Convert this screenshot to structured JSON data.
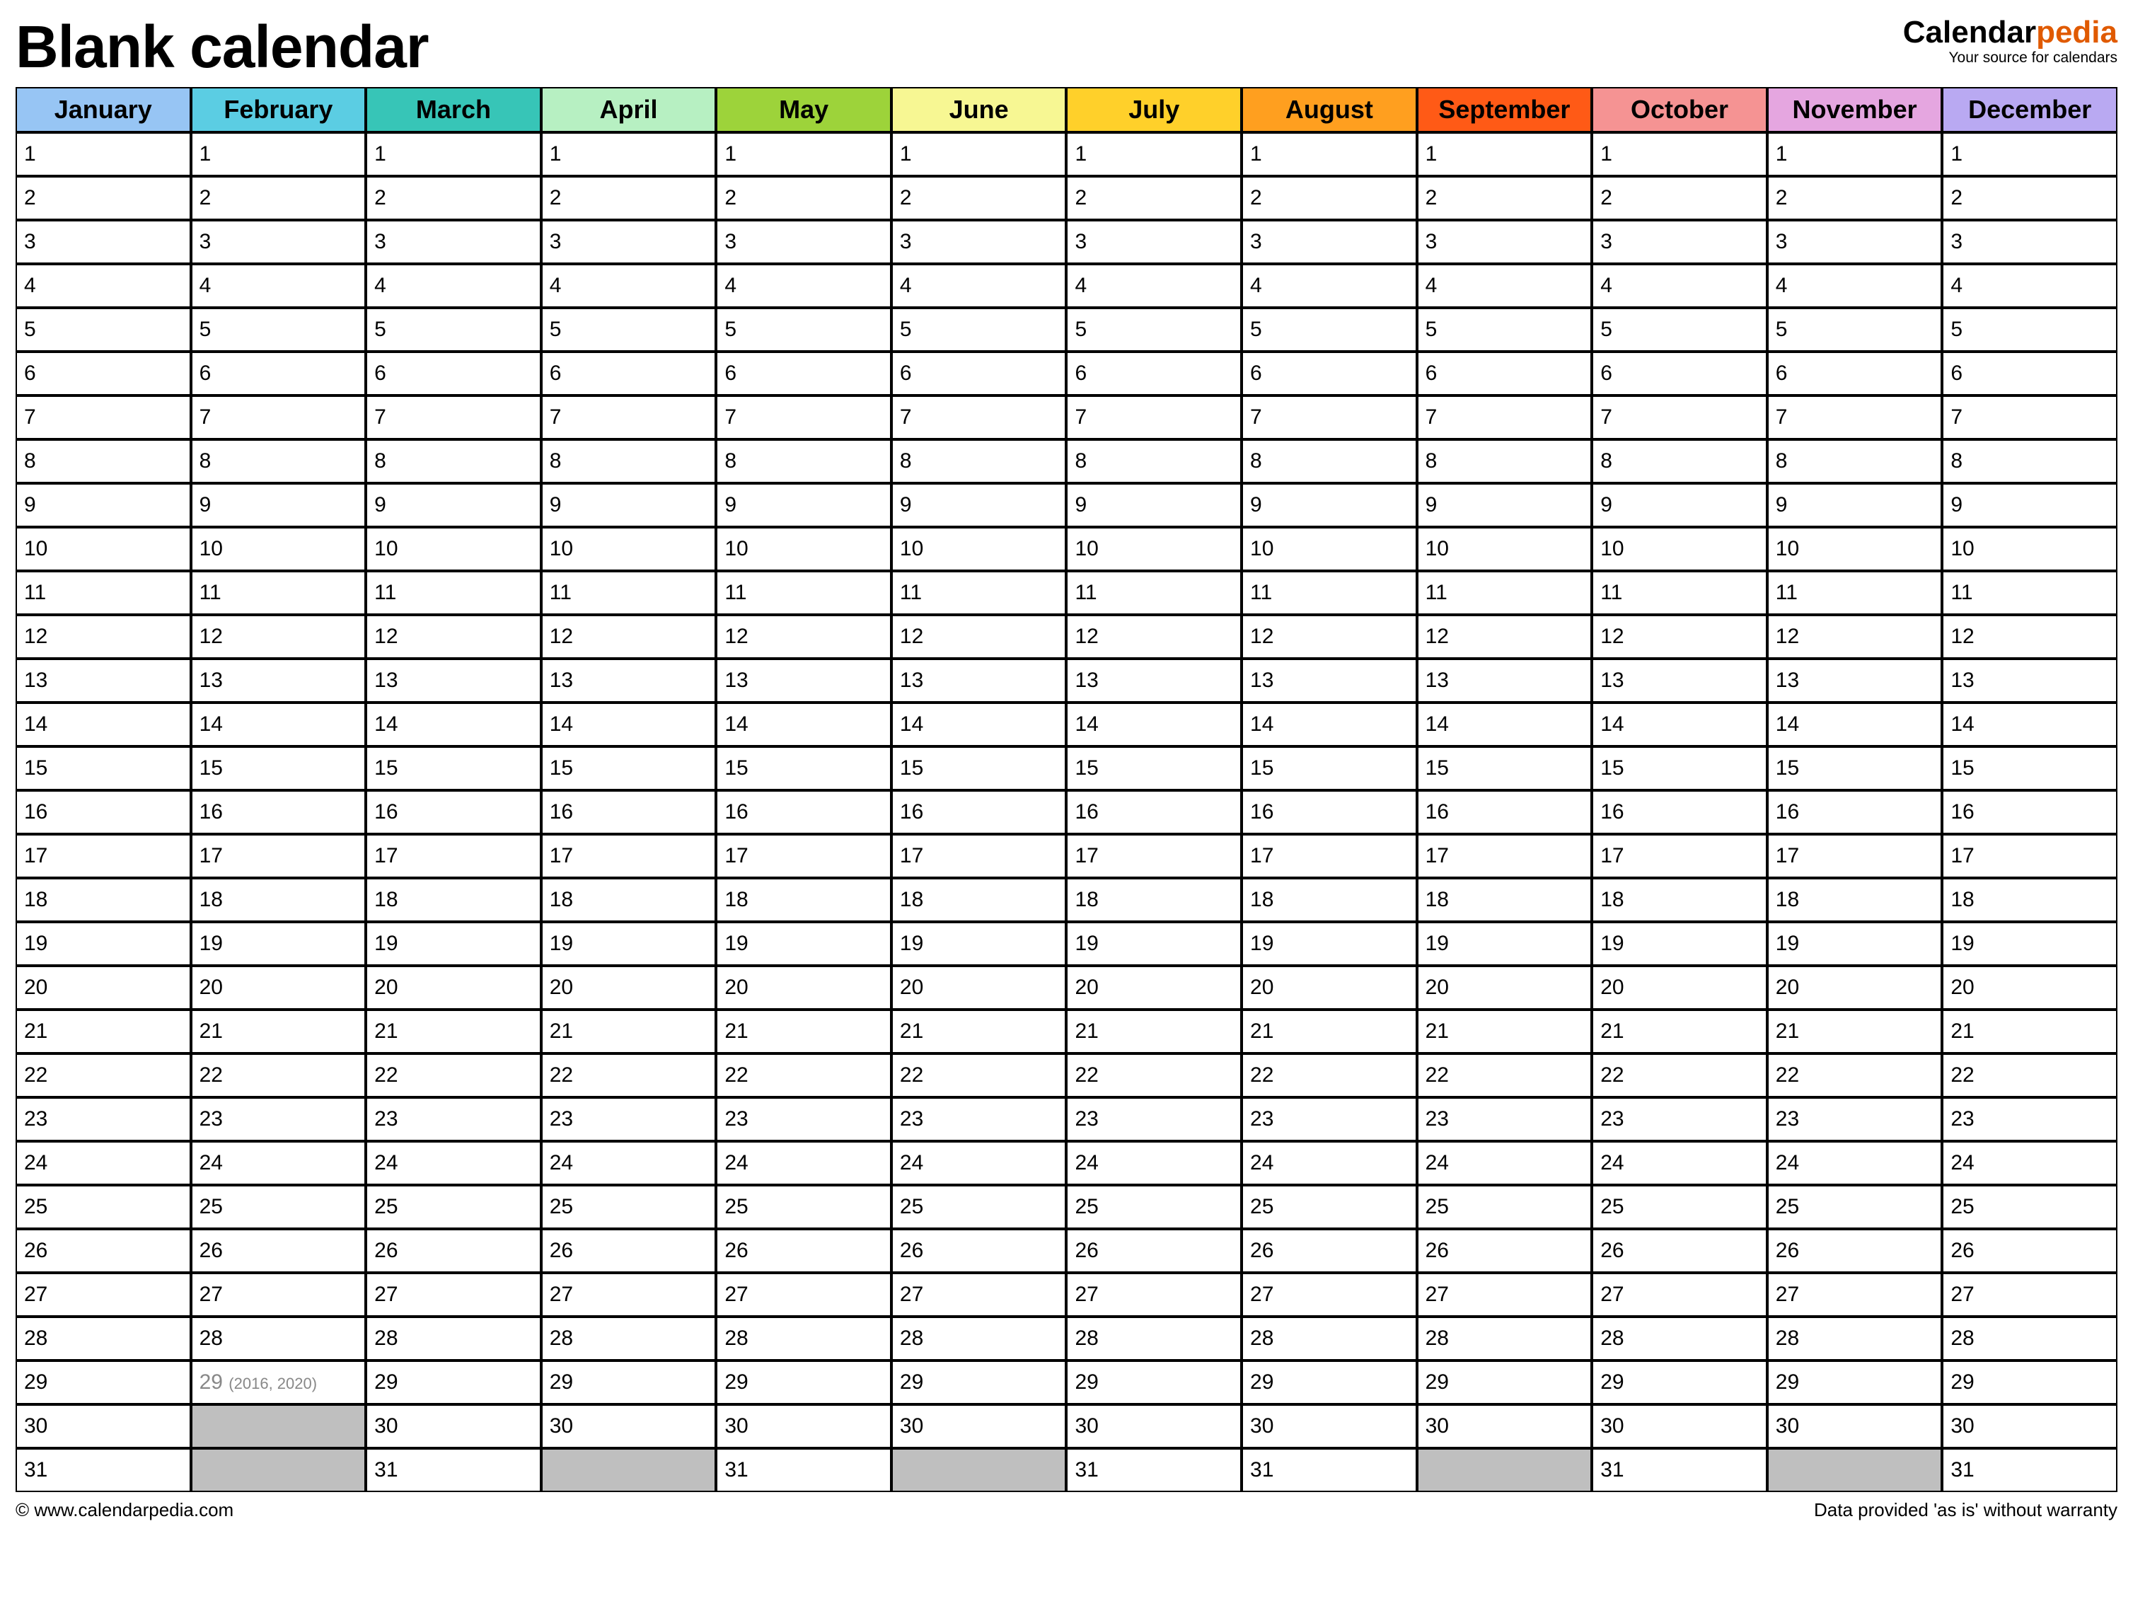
{
  "header": {
    "title": "Blank calendar",
    "brand_prefix": "Calendar",
    "brand_accent": "pedia",
    "brand_tag": "Your source for calendars"
  },
  "months": [
    {
      "name": "January",
      "color": "#97c5f4",
      "days": 31
    },
    {
      "name": "February",
      "color": "#5bcde3",
      "days": 29,
      "leap_day": 29,
      "leap_note": "(2016, 2020)"
    },
    {
      "name": "March",
      "color": "#37c5b7",
      "days": 31
    },
    {
      "name": "April",
      "color": "#b7f0c2",
      "days": 30
    },
    {
      "name": "May",
      "color": "#9dd33a",
      "days": 31
    },
    {
      "name": "June",
      "color": "#f7f793",
      "days": 30
    },
    {
      "name": "July",
      "color": "#ffd02a",
      "days": 31
    },
    {
      "name": "August",
      "color": "#ff9f1f",
      "days": 31
    },
    {
      "name": "September",
      "color": "#ff5a16",
      "days": 30
    },
    {
      "name": "October",
      "color": "#f59393",
      "days": 31
    },
    {
      "name": "November",
      "color": "#e5a6e0",
      "days": 30
    },
    {
      "name": "December",
      "color": "#b9a9f2",
      "days": 31
    }
  ],
  "max_rows": 31,
  "footer": {
    "left": "© www.calendarpedia.com",
    "right": "Data provided 'as is' without warranty"
  }
}
